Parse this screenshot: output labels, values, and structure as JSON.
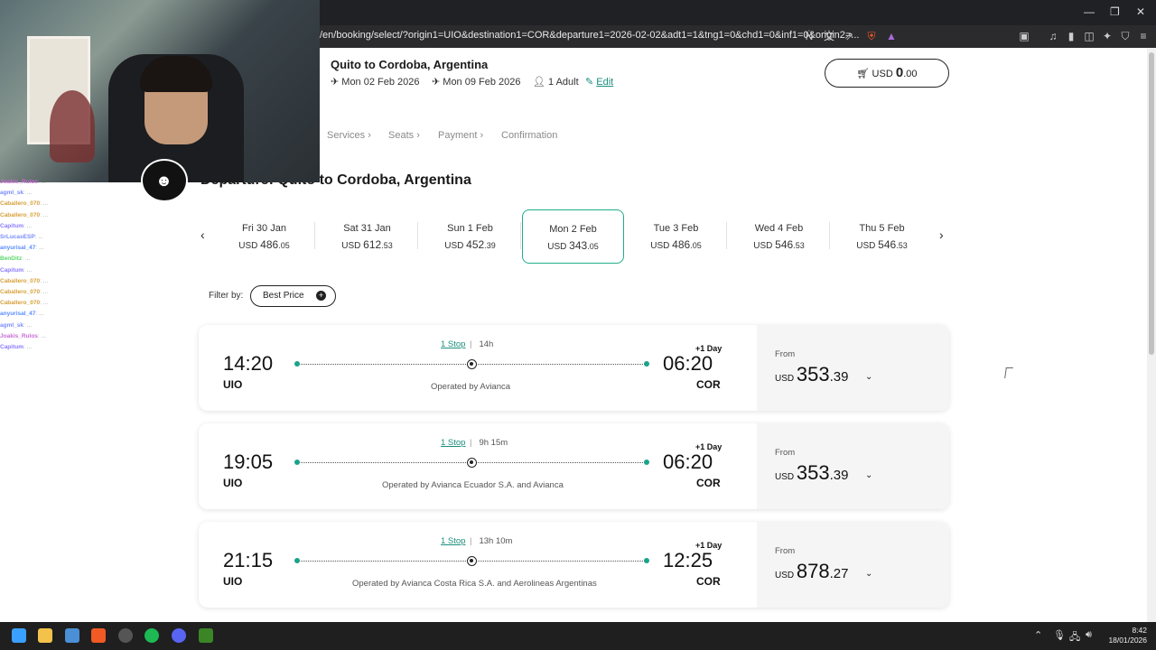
{
  "browser": {
    "url": "/en/booking/select/?origin1=UIO&destination1=COR&departure1=2026-02-02&adt1=1&tng1=0&chd1=0&inf1=0&origin2=..."
  },
  "header": {
    "title": "Quito to Cordoba, Argentina",
    "depart_date": "Mon 02 Feb 2026",
    "return_date": "Mon 09 Feb 2026",
    "passengers": "1 Adult",
    "edit": "Edit",
    "cart_currency": "USD",
    "cart_amount": "0",
    "cart_cents": ".00"
  },
  "steps": [
    "Services",
    "Seats",
    "Payment",
    "Confirmation"
  ],
  "departure_title": "Departure: Quito to Cordoba, Argentina",
  "dates": [
    {
      "day": "Fri 30 Jan",
      "cur": "USD",
      "amt": "486",
      "cents": ".05"
    },
    {
      "day": "Sat 31 Jan",
      "cur": "USD",
      "amt": "612",
      "cents": ".53"
    },
    {
      "day": "Sun 1 Feb",
      "cur": "USD",
      "amt": "452",
      "cents": ".39"
    },
    {
      "day": "Mon 2 Feb",
      "cur": "USD",
      "amt": "343",
      "cents": ".05"
    },
    {
      "day": "Tue 3 Feb",
      "cur": "USD",
      "amt": "486",
      "cents": ".05"
    },
    {
      "day": "Wed 4 Feb",
      "cur": "USD",
      "amt": "546",
      "cents": ".53"
    },
    {
      "day": "Thu 5 Feb",
      "cur": "USD",
      "amt": "546",
      "cents": ".53"
    }
  ],
  "filter": {
    "label": "Filter by:",
    "button": "Best Price"
  },
  "flights": [
    {
      "dep": "14:20",
      "dep_code": "UIO",
      "arr": "06:20",
      "arr_code": "COR",
      "stops": "1 Stop",
      "duration": "14h",
      "plus_day": "+1 Day",
      "operated": "Operated by Avianca",
      "from": "From",
      "cur": "USD",
      "amt": "353",
      "cents": ".39"
    },
    {
      "dep": "19:05",
      "dep_code": "UIO",
      "arr": "06:20",
      "arr_code": "COR",
      "stops": "1 Stop",
      "duration": "9h 15m",
      "plus_day": "+1 Day",
      "operated": "Operated by Avianca Ecuador S.A. and Avianca",
      "from": "From",
      "cur": "USD",
      "amt": "353",
      "cents": ".39"
    },
    {
      "dep": "21:15",
      "dep_code": "UIO",
      "arr": "12:25",
      "arr_code": "COR",
      "stops": "1 Stop",
      "duration": "13h 10m",
      "plus_day": "+1 Day",
      "operated": "Operated by Avianca Costa Rica S.A. and Aerolineas Argentinas",
      "from": "From",
      "cur": "USD",
      "amt": "878",
      "cents": ".27"
    }
  ],
  "chat": [
    {
      "user": "Joakis_Rulos",
      "msg": ": ..."
    },
    {
      "user": "agml_sk",
      "msg": ": ..."
    },
    {
      "user": "Caballero_070",
      "msg": ": ..."
    },
    {
      "user": "Caballero_070",
      "msg": ": ..."
    },
    {
      "user": "Capitum",
      "msg": ": ..."
    },
    {
      "user": "SrLucasESP",
      "msg": ": ..."
    },
    {
      "user": "anyurisal_47",
      "msg": ": ..."
    },
    {
      "user": "BenDitz",
      "msg": ": ..."
    },
    {
      "user": "Capitum",
      "msg": ": ..."
    },
    {
      "user": "Caballero_070",
      "msg": ": ..."
    },
    {
      "user": "Caballero_070",
      "msg": ": ..."
    },
    {
      "user": "Caballero_070",
      "msg": ": ..."
    },
    {
      "user": "anyurisal_47",
      "msg": ": ..."
    },
    {
      "user": "agml_sk",
      "msg": ": ..."
    },
    {
      "user": "Joakis_Rulos",
      "msg": ": ..."
    },
    {
      "user": "Capitum",
      "msg": ": ..."
    }
  ],
  "clock": {
    "time": "8:42",
    "date": "18/01/2026"
  },
  "colors": {
    "accent": "#1fae8a",
    "link": "#1b8f7e"
  }
}
